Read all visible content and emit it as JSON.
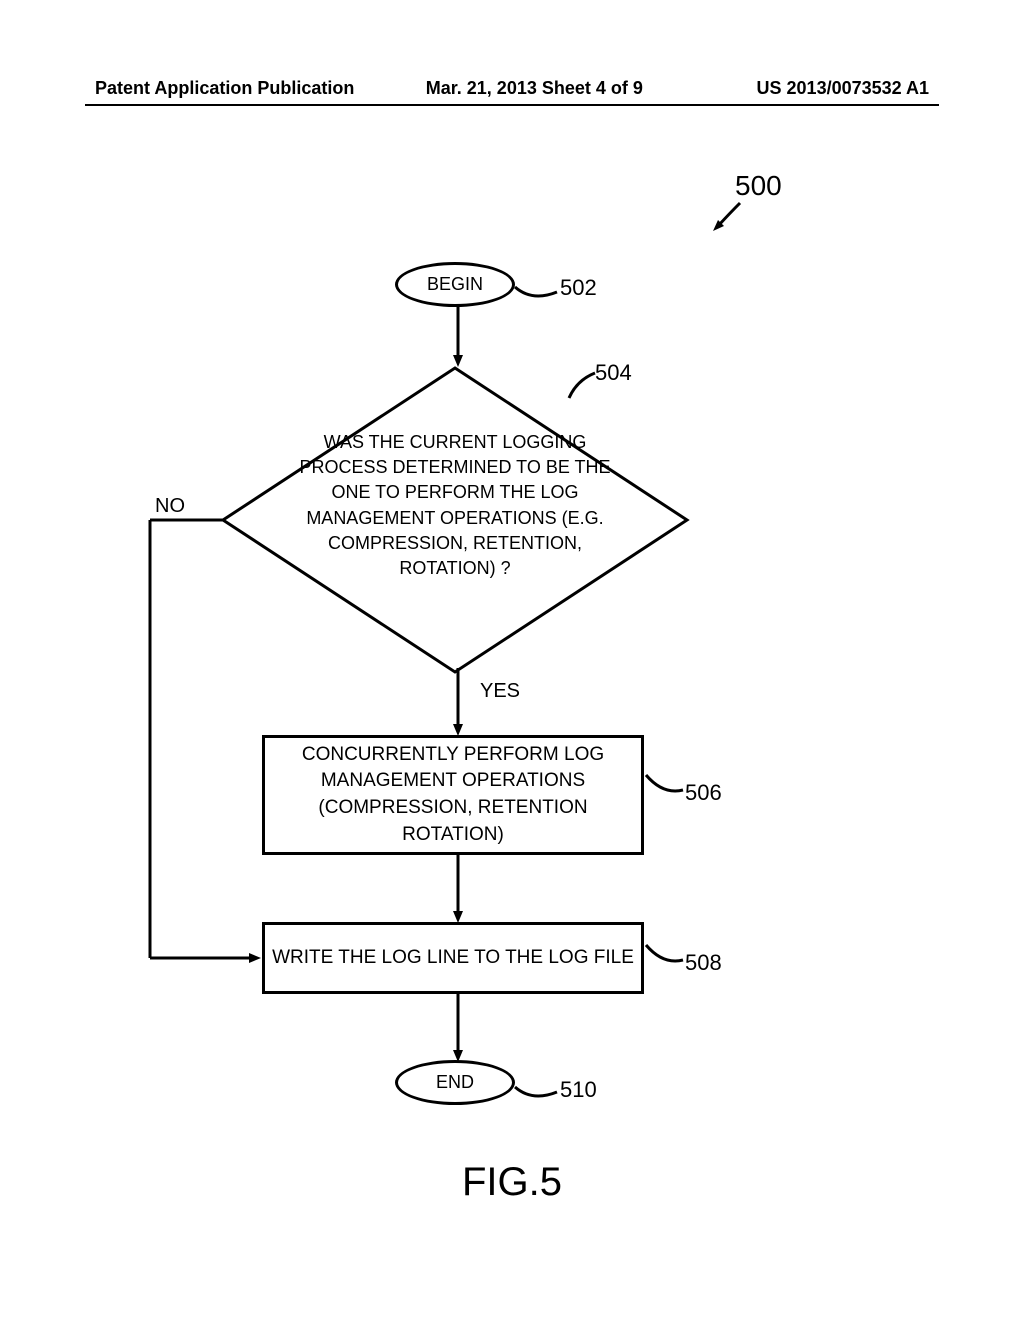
{
  "header": {
    "left": "Patent Application Publication",
    "center": "Mar. 21, 2013  Sheet 4 of 9",
    "right": "US 2013/0073532 A1"
  },
  "flowchart": {
    "ref_500": "500",
    "begin": "BEGIN",
    "ref_502": "502",
    "decision": "WAS THE CURRENT LOGGING PROCESS DETERMINED TO BE THE ONE TO PERFORM THE LOG MANAGEMENT OPERATIONS (E.G. COMPRESSION, RETENTION, ROTATION) ?",
    "ref_504": "504",
    "no_label": "NO",
    "yes_label": "YES",
    "box_506": "CONCURRENTLY PERFORM LOG MANAGEMENT OPERATIONS (COMPRESSION, RETENTION ROTATION)",
    "ref_506": "506",
    "box_508": "WRITE THE LOG LINE TO THE LOG FILE",
    "ref_508": "508",
    "end": "END",
    "ref_510": "510",
    "figure_label": "FIG.5"
  }
}
